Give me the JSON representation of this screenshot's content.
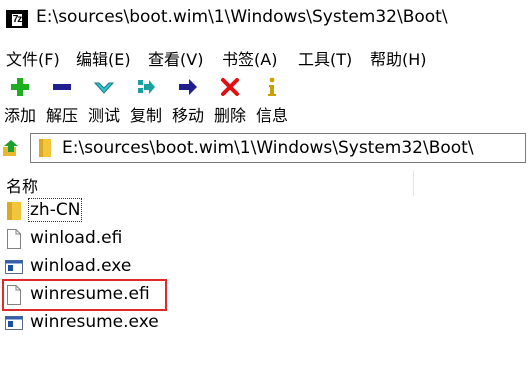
{
  "window": {
    "title": "E:\\sources\\boot.wim\\1\\Windows\\System32\\Boot\\",
    "app_icon_text": "7z"
  },
  "menu": [
    {
      "label": "文件(F)"
    },
    {
      "label": "编辑(E)"
    },
    {
      "label": "查看(V)"
    },
    {
      "label": "书签(A)"
    },
    {
      "label": "工具(T)"
    },
    {
      "label": "帮助(H)"
    }
  ],
  "toolbar": {
    "add": "添加",
    "extract": "解压",
    "test": "测试",
    "copy": "复制",
    "move": "移动",
    "delete": "删除",
    "info": "信息"
  },
  "address": {
    "path": "E:\\sources\\boot.wim\\1\\Windows\\System32\\Boot\\"
  },
  "list": {
    "column_name": "名称",
    "items": [
      {
        "name": "zh-CN",
        "type": "folder"
      },
      {
        "name": "winload.efi",
        "type": "file"
      },
      {
        "name": "winload.exe",
        "type": "exe"
      },
      {
        "name": "winresume.efi",
        "type": "file"
      },
      {
        "name": "winresume.exe",
        "type": "exe"
      }
    ]
  },
  "colors": {
    "highlight": "#e0292b",
    "add_green": "#1fae1f",
    "nav_blue": "#1f1f8f",
    "delete_red": "#e01010",
    "folder_yellow": "#f2c53d"
  }
}
